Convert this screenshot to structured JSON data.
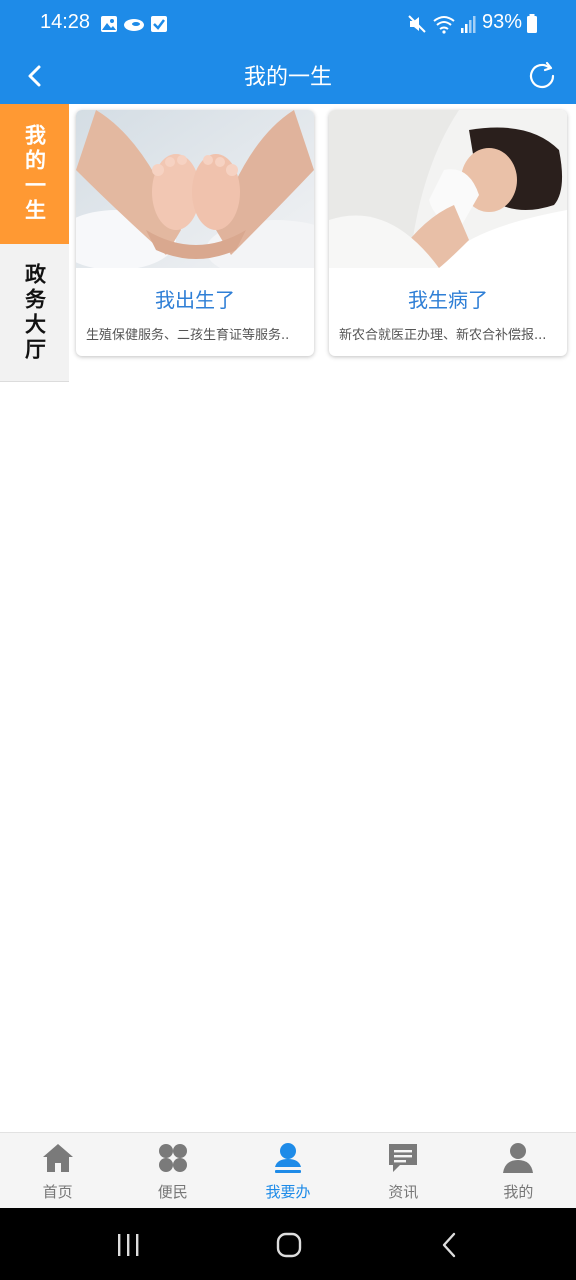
{
  "status_bar": {
    "time": "14:28",
    "battery": "93%",
    "icons": [
      "gallery-icon",
      "cloud-icon",
      "checkbox-icon",
      "mute-icon",
      "wifi-icon",
      "signal-icon",
      "battery-icon"
    ]
  },
  "header": {
    "title": "我的一生",
    "back_icon": "chevron-left-icon",
    "refresh_icon": "refresh-icon"
  },
  "side_tabs": [
    {
      "label": "我的一生",
      "active": true
    },
    {
      "label": "政务大厅",
      "active": false
    }
  ],
  "cards": [
    {
      "title": "我出生了",
      "desc": "生殖保健服务、二孩生育证等服务..",
      "image": "baby-feet-photo"
    },
    {
      "title": "我生病了",
      "desc": "新农合就医正办理、新农合补偿报...",
      "image": "sick-woman-photo"
    }
  ],
  "bottom_nav": [
    {
      "label": "首页",
      "icon": "home-icon",
      "active": false
    },
    {
      "label": "便民",
      "icon": "grid-icon",
      "active": false
    },
    {
      "label": "我要办",
      "icon": "user-service-icon",
      "active": true
    },
    {
      "label": "资讯",
      "icon": "message-icon",
      "active": false
    },
    {
      "label": "我的",
      "icon": "person-icon",
      "active": false
    }
  ],
  "colors": {
    "primary": "#1e8be8",
    "tab_active": "#ff9933",
    "card_title": "#2f7fd6",
    "nav_inactive": "#777777"
  }
}
